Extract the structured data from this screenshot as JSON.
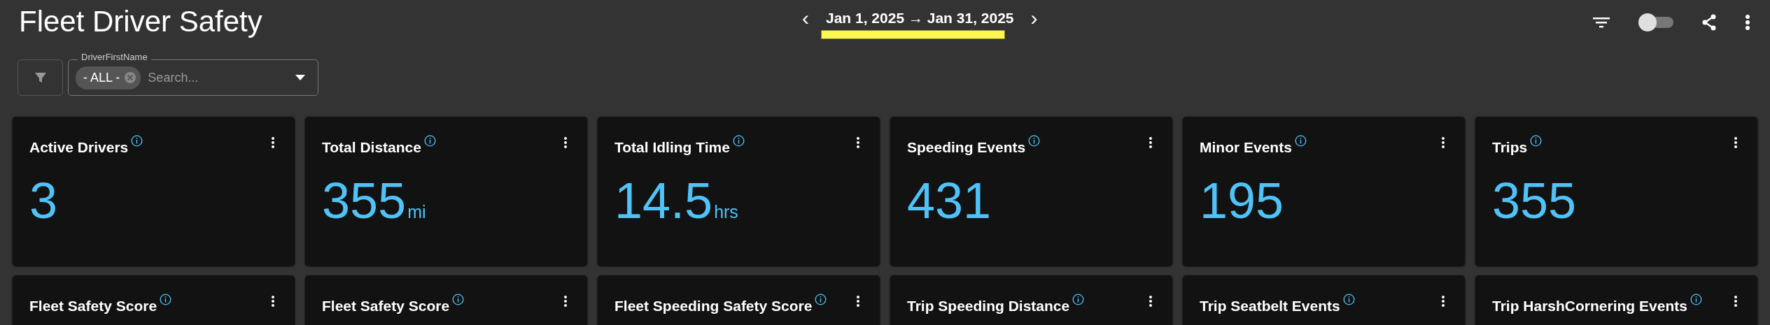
{
  "title": "Fleet Driver Safety",
  "date_range": {
    "prev": "‹",
    "start": "Jan 1, 2025",
    "arrow": "→",
    "end": "Jan 31, 2025",
    "next": "›"
  },
  "toolbar": {
    "toggle": {
      "on": false
    }
  },
  "filter": {
    "label": "DriverFirstName",
    "chips": [
      "- ALL -"
    ],
    "placeholder": "Search..."
  },
  "cards": [
    {
      "title": "Active Drivers",
      "value": "3"
    },
    {
      "title": "Total Distance",
      "value": "355",
      "unit": "mi"
    },
    {
      "title": "Total Idling Time",
      "value": "14.5",
      "unit": "hrs"
    },
    {
      "title": "Speeding Events",
      "value": "431"
    },
    {
      "title": "Minor Events",
      "value": "195"
    },
    {
      "title": "Trips",
      "value": "355"
    },
    {
      "title": "Fleet Safety Score"
    },
    {
      "title": "Fleet Safety Score"
    },
    {
      "title": "Fleet Speeding Safety Score"
    },
    {
      "title": "Trip Speeding Distance"
    },
    {
      "title": "Trip Seatbelt Events"
    },
    {
      "title": "Trip HarshCornering Events"
    }
  ]
}
